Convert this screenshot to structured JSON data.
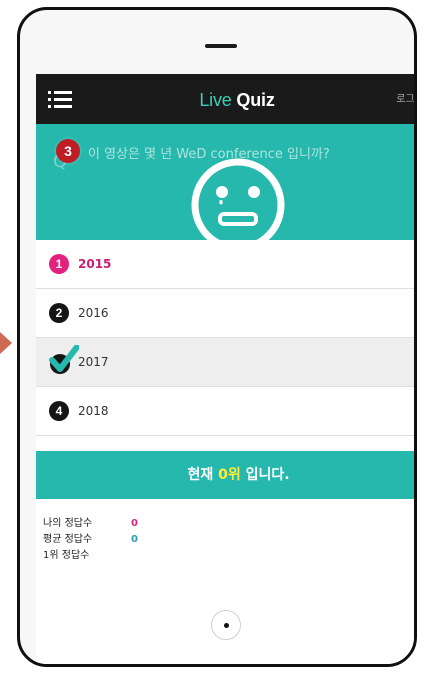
{
  "app": {
    "title_live": "Live",
    "title_quiz": "Quiz",
    "logout_label": "로그아웃"
  },
  "colors": {
    "accent": "#27b8ad",
    "title_live": "#39cfb5",
    "selected_pink": "#e3227d",
    "question_badge": "#bf1c24",
    "highlight_yellow": "#ffef3a"
  },
  "question": {
    "number": "3",
    "text": "이 영상은 몇 년 WeD conference 입니까?"
  },
  "choices": [
    {
      "number": "1",
      "label": "2015",
      "state": "highlighted"
    },
    {
      "number": "2",
      "label": "2016",
      "state": "normal"
    },
    {
      "number": "3",
      "label": "2017",
      "state": "selected"
    },
    {
      "number": "4",
      "label": "2018",
      "state": "normal"
    }
  ],
  "rank": {
    "prefix": "현재 ",
    "value": "0위",
    "suffix": " 입니다."
  },
  "stats": [
    {
      "label": "나의 정답수",
      "value": "0",
      "color": "#d22b81"
    },
    {
      "label": "평균 정답수",
      "value": "0",
      "color": "#2a9fb0"
    },
    {
      "label": "1위 정답수",
      "value": "",
      "color": "#222222"
    }
  ],
  "icons": {
    "menu": "hamburger-menu-icon",
    "face": "sad-face-icon",
    "checkmark": "check-icon",
    "home": "home-button-icon"
  }
}
